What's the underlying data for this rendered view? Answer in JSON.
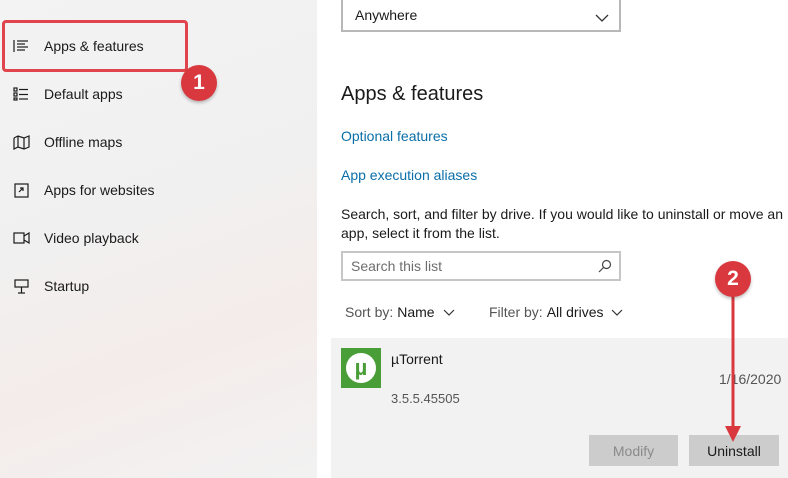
{
  "sidebar": {
    "items": [
      {
        "label": "Apps & features",
        "icon": "apps-features-icon"
      },
      {
        "label": "Default apps",
        "icon": "default-apps-icon"
      },
      {
        "label": "Offline maps",
        "icon": "map-icon"
      },
      {
        "label": "Apps for websites",
        "icon": "open-in-icon"
      },
      {
        "label": "Video playback",
        "icon": "video-icon"
      },
      {
        "label": "Startup",
        "icon": "startup-icon"
      }
    ],
    "selected_index": 0
  },
  "main": {
    "install_source": {
      "value": "Anywhere"
    },
    "title": "Apps & features",
    "links": {
      "optional_features": "Optional features",
      "app_execution_aliases": "App execution aliases"
    },
    "description": "Search, sort, and filter by drive. If you would like to uninstall or move an app, select it from the list.",
    "search": {
      "placeholder": "Search this list"
    },
    "sort": {
      "label": "Sort by:",
      "value": "Name"
    },
    "filter": {
      "label": "Filter by:",
      "value": "All drives"
    },
    "app": {
      "name": "µTorrent",
      "version": "3.5.5.45505",
      "date": "1/16/2020",
      "icon_letter": "µ",
      "modify_label": "Modify",
      "uninstall_label": "Uninstall"
    }
  },
  "annotations": {
    "step1": "1",
    "step2": "2",
    "highlight_color": "#e0444c",
    "badge_color": "#d9383f"
  },
  "colors": {
    "link": "#0a6ea8",
    "sidebar_bg": "#f3f3f3",
    "card_bg": "#f2f2f2"
  }
}
